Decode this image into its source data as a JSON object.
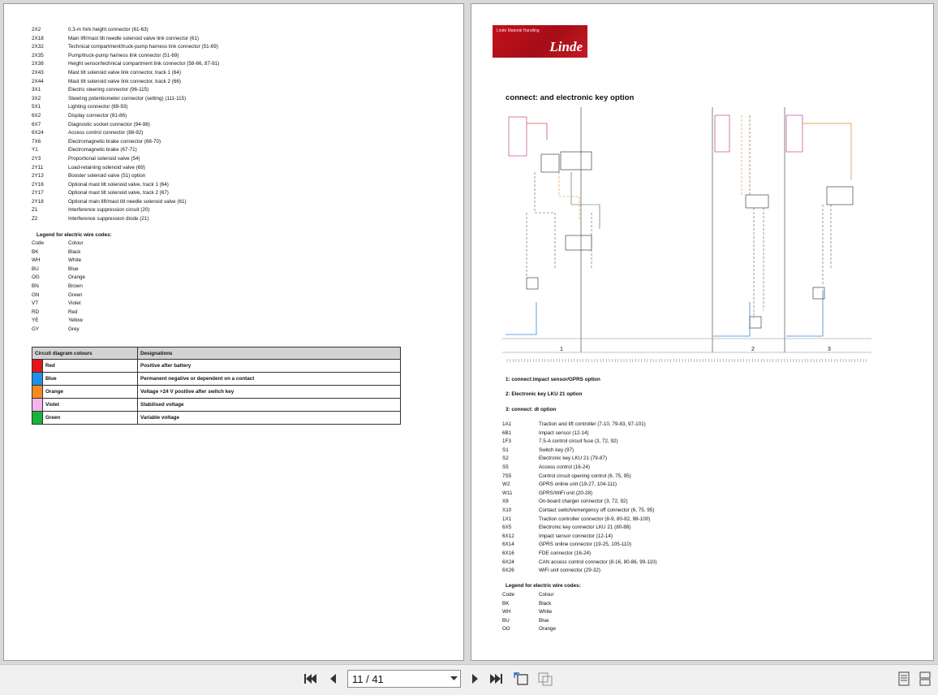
{
  "left_page": {
    "connectors": [
      {
        "code": "2X2",
        "desc": "0.3-m fork height connector (61-63)"
      },
      {
        "code": "2X18",
        "desc": "Main lift/mast tilt needle solenoid valve link connector (61)"
      },
      {
        "code": "2X32",
        "desc": "Technical compartment/truck-pump harness link connector (51-69)"
      },
      {
        "code": "2X35",
        "desc": "Pump/truck-pump harness link connector (51-69)"
      },
      {
        "code": "2X38",
        "desc": "Height sensor/technical compartment link connector (58-66, 87-91)"
      },
      {
        "code": "2X43",
        "desc": "Mast tilt solenoid valve link connector, track 1 (64)"
      },
      {
        "code": "2X44",
        "desc": "Mast tilt solenoid valve link connector, track 2 (66)"
      },
      {
        "code": "3X1",
        "desc": "Electric steering connector (96-115)"
      },
      {
        "code": "3X2",
        "desc": "Steering potentiometer connector (setting) (111-115)"
      },
      {
        "code": "5X1",
        "desc": "Lighting connector (89-93)"
      },
      {
        "code": "6X2",
        "desc": "Display connector (81-86)"
      },
      {
        "code": "6X7",
        "desc": "Diagnostic socket connector (94-98)"
      },
      {
        "code": "6X24",
        "desc": "Access control connector (88-92)"
      },
      {
        "code": "7X6",
        "desc": "Electromagnetic brake connector (68-70)"
      },
      {
        "code": "Y1",
        "desc": "Electromagnetic brake (67-71)"
      },
      {
        "code": "2Y3",
        "desc": "Proportional solenoid valve (54)"
      },
      {
        "code": "2Y11",
        "desc": "Load-retaining solenoid valve (69)"
      },
      {
        "code": "2Y13",
        "desc": "Booster solenoid valve (51) option"
      },
      {
        "code": "2Y16",
        "desc": "Optional mast tilt solenoid valve, track 1 (64)"
      },
      {
        "code": "2Y17",
        "desc": "Optional mast tilt solenoid valve, track 2 (67)"
      },
      {
        "code": "2Y18",
        "desc": "Optional main lift/mast tilt needle solenoid valve (61)"
      },
      {
        "code": "Z1",
        "desc": "Interference suppression circuit (20)"
      },
      {
        "code": "Z2",
        "desc": "Interference suppression diode (21)"
      }
    ],
    "legend_title": "Legend for electric wire codes:",
    "wire_codes": [
      {
        "code": "Code",
        "desc": "Colour"
      },
      {
        "code": "BK",
        "desc": "Black"
      },
      {
        "code": "WH",
        "desc": "White"
      },
      {
        "code": "BU",
        "desc": "Blue"
      },
      {
        "code": "OG",
        "desc": "Orange"
      },
      {
        "code": "BN",
        "desc": "Brown"
      },
      {
        "code": "GN",
        "desc": "Green"
      },
      {
        "code": "VT",
        "desc": "Violet"
      },
      {
        "code": "RD",
        "desc": "Red"
      },
      {
        "code": "YE",
        "desc": "Yellow"
      },
      {
        "code": "GY",
        "desc": "Grey"
      }
    ],
    "color_table": {
      "header_left": "Circuit diagram colours",
      "header_right": "Designations",
      "rows": [
        {
          "swatch": "#e8141a",
          "name": "Red",
          "designation": "Positive after battery"
        },
        {
          "swatch": "#1f8fe8",
          "name": "Blue",
          "designation": "Permanent negative or dependent on a contact"
        },
        {
          "swatch": "#f58a1f",
          "name": "Orange",
          "designation": "Voltage +24 V positive after switch key"
        },
        {
          "swatch": "#f3b6ea",
          "name": "Violet",
          "designation": "Stabilised voltage"
        },
        {
          "swatch": "#17b33a",
          "name": "Green",
          "designation": "Variable voltage"
        }
      ]
    }
  },
  "right_page": {
    "logo_small": "Linde Material Handling",
    "logo_big": "Linde",
    "title": "connect: and electronic key option",
    "diagram_labels": [
      "1",
      "2",
      "3"
    ],
    "options": [
      "1: connect:impact sensor/GPRS option",
      "2: Electronic key LKU 21 option",
      "3: connect: dt option"
    ],
    "components": [
      {
        "code": "1A1",
        "desc": "Traction and lift controller (7-10, 79-83, 97-101)"
      },
      {
        "code": "6B1",
        "desc": "Impact sensor (12-14)"
      },
      {
        "code": "1F3",
        "desc": "7.5-A control circuit fuse (3, 72, 92)"
      },
      {
        "code": "S1",
        "desc": "Switch key (97)"
      },
      {
        "code": "S2",
        "desc": "Electronic key LKU 21 (79-87)"
      },
      {
        "code": "S5",
        "desc": "Access control (16-24)"
      },
      {
        "code": "7S5",
        "desc": "Control circuit opening control (6, 75, 95)"
      },
      {
        "code": "W2",
        "desc": "GPRS online unit (19-27, 104-111)"
      },
      {
        "code": "W11",
        "desc": "GPRS/WiFi unit (20-28)"
      },
      {
        "code": "X8",
        "desc": "On-board charger connector (3, 72, 92)"
      },
      {
        "code": "X10",
        "desc": "Contact switch/emergency off connector (6, 75, 95)"
      },
      {
        "code": "1X1",
        "desc": "Traction controller connector (8-9, 80-82, 98-100)"
      },
      {
        "code": "6X5",
        "desc": "Electronic key connector LKU 21 (80-88)"
      },
      {
        "code": "6X12",
        "desc": "Impact sensor connector (12-14)"
      },
      {
        "code": "6X14",
        "desc": "GPRS online connector (19-25, 105-110)"
      },
      {
        "code": "6X16",
        "desc": "FDE connector (16-24)"
      },
      {
        "code": "6X24",
        "desc": "CAN access control connector (8-16, 80-86, 99-110)"
      },
      {
        "code": "6X26",
        "desc": "WiFi unit connector (29-32)"
      }
    ],
    "legend_title": "Legend for electric wire codes:",
    "wire_codes": [
      {
        "code": "Code",
        "desc": "Colour"
      },
      {
        "code": "BK",
        "desc": "Black"
      },
      {
        "code": "WH",
        "desc": "White"
      },
      {
        "code": "BU",
        "desc": "Blue"
      },
      {
        "code": "OG",
        "desc": "Orange"
      }
    ]
  },
  "toolbar": {
    "page_indicator": "11 / 41",
    "icons": [
      "first-page-icon",
      "prev-page-icon",
      "next-page-icon",
      "last-page-icon",
      "single-page-view-icon",
      "continuous-view-icon"
    ]
  }
}
